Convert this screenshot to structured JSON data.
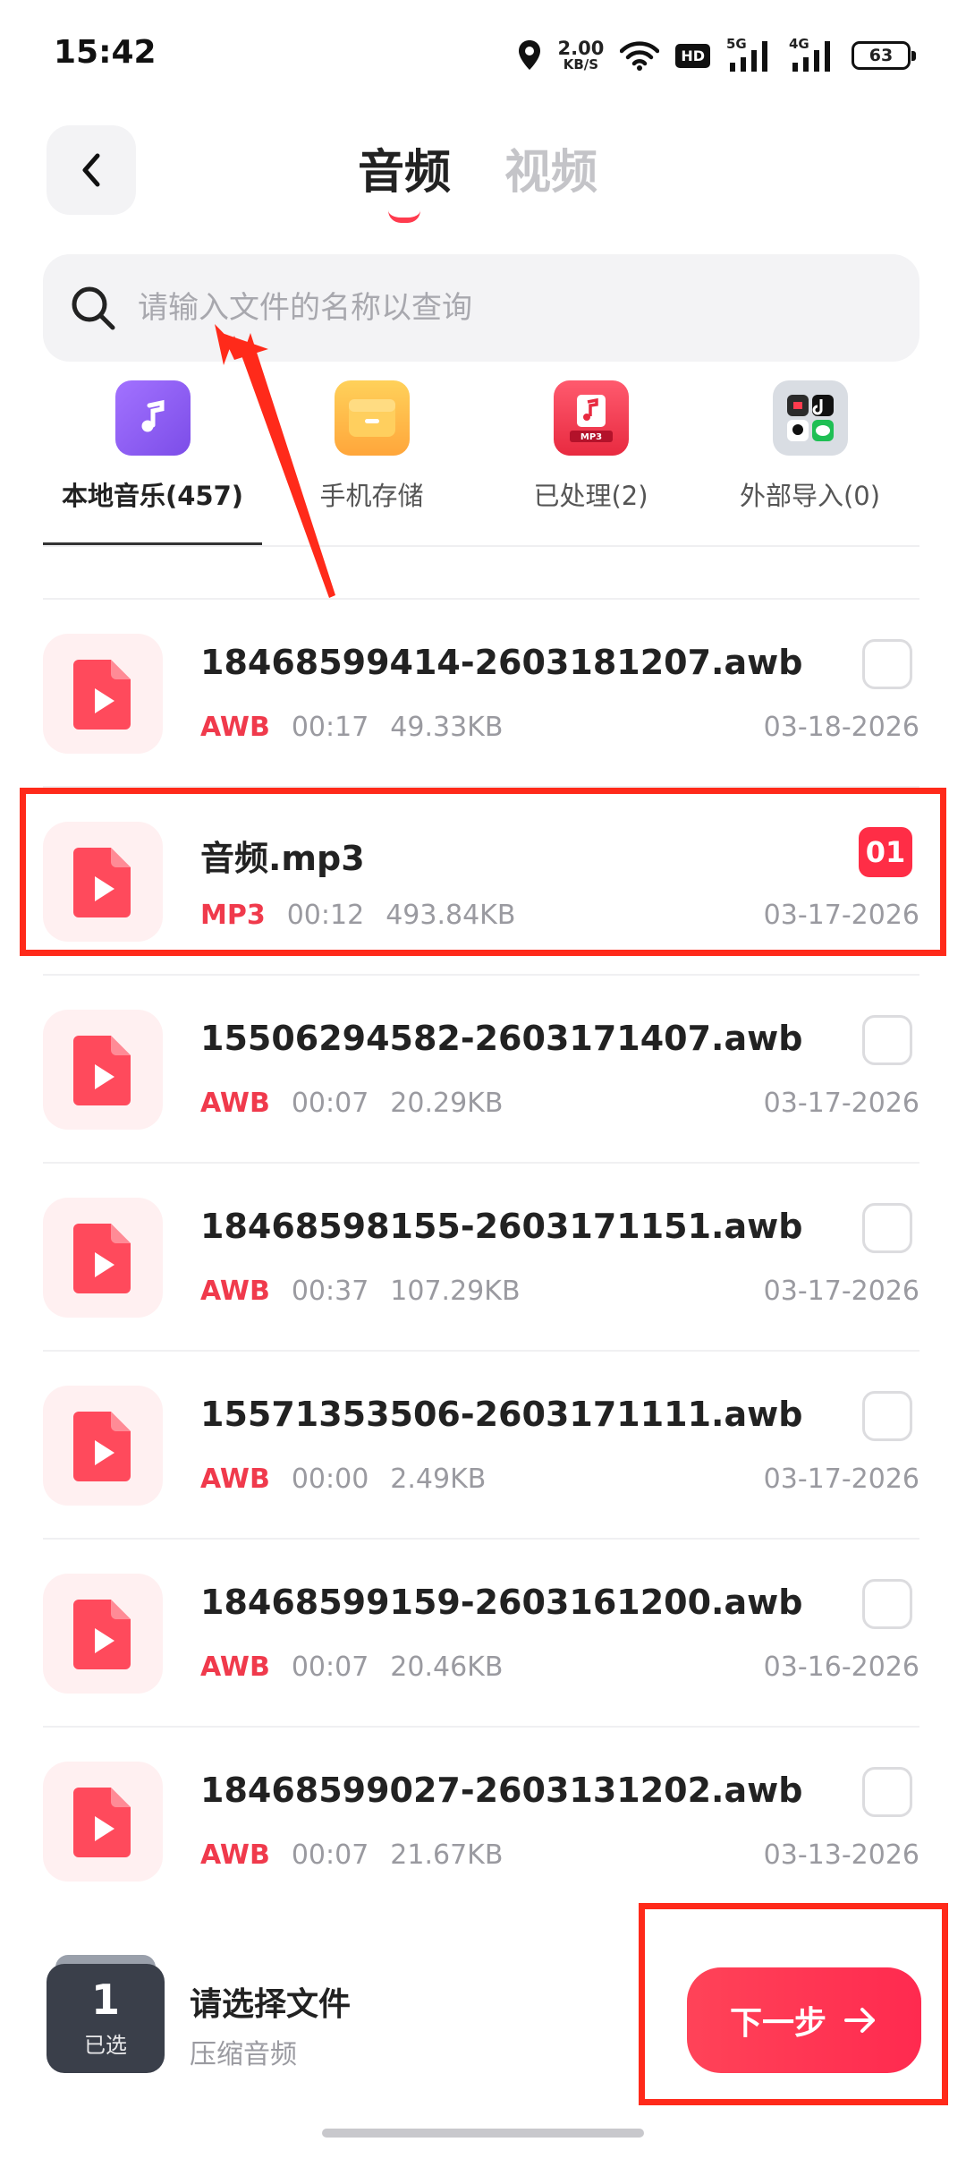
{
  "status_bar": {
    "time": "15:42",
    "speed_value": "2.00",
    "speed_unit": "KB/S",
    "hd_label": "HD",
    "sig1_label": "5G",
    "sig2_label": "4G",
    "battery": "63"
  },
  "header": {
    "tabs": [
      {
        "label": "音频",
        "active": true
      },
      {
        "label": "视频",
        "active": false
      }
    ]
  },
  "search": {
    "placeholder": "请输入文件的名称以查询",
    "value": ""
  },
  "categories": [
    {
      "label": "本地音乐(457)",
      "icon": "music-note-icon",
      "color": "#8a5cf0",
      "active": true
    },
    {
      "label": "手机存储",
      "icon": "folder-icon",
      "color": "#ffb340",
      "active": false
    },
    {
      "label": "已处理(2)",
      "icon": "processed-mp3-icon",
      "color": "#f0364c",
      "active": false
    },
    {
      "label": "外部导入(0)",
      "icon": "external-apps-icon",
      "color": "#d9dde3",
      "active": false
    }
  ],
  "files": [
    {
      "name": "18468599414-2603181207.awb",
      "format": "AWB",
      "duration": "00:17",
      "size": "49.33KB",
      "date": "03-18-2026",
      "selected_order": ""
    },
    {
      "name": "音频.mp3",
      "format": "MP3",
      "duration": "00:12",
      "size": "493.84KB",
      "date": "03-17-2026",
      "selected_order": "01"
    },
    {
      "name": "15506294582-2603171407.awb",
      "format": "AWB",
      "duration": "00:07",
      "size": "20.29KB",
      "date": "03-17-2026",
      "selected_order": ""
    },
    {
      "name": "18468598155-2603171151.awb",
      "format": "AWB",
      "duration": "00:37",
      "size": "107.29KB",
      "date": "03-17-2026",
      "selected_order": ""
    },
    {
      "name": "15571353506-2603171111.awb",
      "format": "AWB",
      "duration": "00:00",
      "size": "2.49KB",
      "date": "03-17-2026",
      "selected_order": ""
    },
    {
      "name": "18468599159-2603161200.awb",
      "format": "AWB",
      "duration": "00:07",
      "size": "20.46KB",
      "date": "03-16-2026",
      "selected_order": ""
    },
    {
      "name": "18468599027-2603131202.awb",
      "format": "AWB",
      "duration": "00:07",
      "size": "21.67KB",
      "date": "03-13-2026",
      "selected_order": ""
    }
  ],
  "bottom_bar": {
    "selected_count": "1",
    "selected_label": "已选",
    "title": "请选择文件",
    "subtitle": "压缩音频",
    "next_label": "下一步"
  },
  "colors": {
    "accent": "#ff2d46",
    "annotation": "#ff2a1a"
  }
}
